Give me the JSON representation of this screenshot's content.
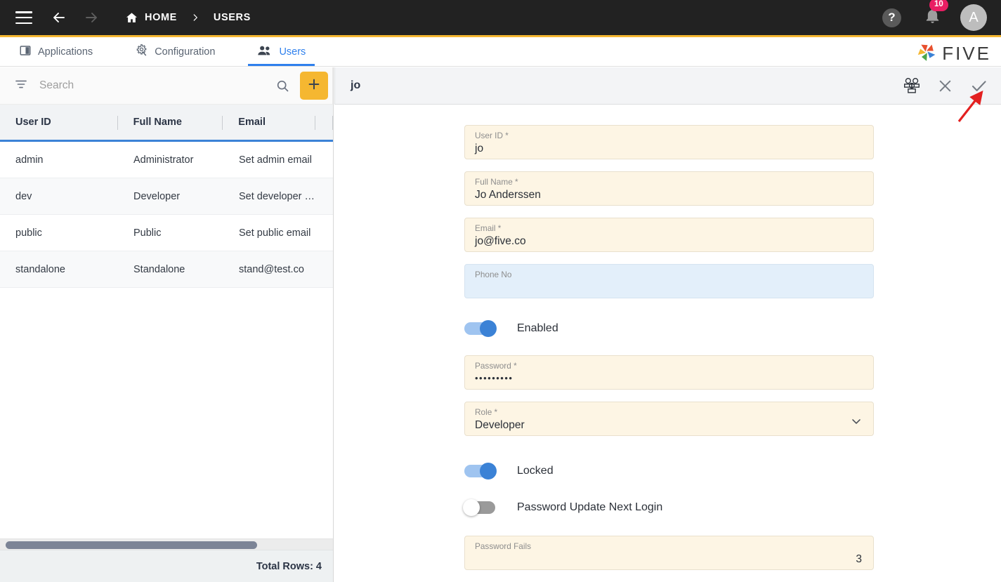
{
  "topbar": {
    "menu_icon": "hamburger-menu-icon",
    "back_icon": "arrow-back-icon",
    "forward_icon": "arrow-forward-icon",
    "home_icon": "home-icon",
    "breadcrumb_home": "HOME",
    "breadcrumb_sep": "chevron-right-icon",
    "breadcrumb_current": "USERS",
    "help_label": "?",
    "bell_icon": "notification-bell-icon",
    "notification_count": "10",
    "avatar_initial": "A",
    "accent_underline": "#F5B731",
    "bg": "#222222",
    "badge_color": "#E91E63"
  },
  "tabs": [
    {
      "label": "Applications",
      "icon": "applications-icon",
      "active": false
    },
    {
      "label": "Configuration",
      "icon": "configuration-gear-icon",
      "active": false
    },
    {
      "label": "Users",
      "icon": "users-group-icon",
      "active": true
    }
  ],
  "brand": {
    "name": "FIVE",
    "logo_icon": "five-pinwheel-logo-icon",
    "logo_colors": [
      "#E8502E",
      "#F5B731",
      "#4CA64C",
      "#3B82D6",
      "#E8502E"
    ]
  },
  "left_panel": {
    "filter_icon": "filter-icon",
    "search": {
      "value": "",
      "placeholder": "Search"
    },
    "search_icon": "search-icon",
    "add_button": {
      "icon": "plus-icon",
      "color": "#F5B731"
    },
    "columns": [
      "User ID",
      "Full Name",
      "Email",
      ""
    ],
    "rows": [
      {
        "user_id": "admin",
        "full_name": "Administrator",
        "email": "Set admin email"
      },
      {
        "user_id": "dev",
        "full_name": "Developer",
        "email": "Set developer em…"
      },
      {
        "user_id": "public",
        "full_name": "Public",
        "email": "Set public email"
      },
      {
        "user_id": "standalone",
        "full_name": "Standalone",
        "email": "stand@test.co"
      }
    ],
    "footer_total": "Total Rows: 4",
    "scrollbar": "horizontal-scrollbar"
  },
  "detail_panel": {
    "title": "jo",
    "actions": [
      {
        "name": "user-groups-icon",
        "glyph": "group"
      },
      {
        "name": "close-icon",
        "glyph": "x"
      },
      {
        "name": "save-check-icon",
        "glyph": "check"
      }
    ],
    "fields": [
      {
        "label": "User ID *",
        "value": "jo",
        "state": "normal"
      },
      {
        "label": "Full Name *",
        "value": "Jo Anderssen",
        "state": "normal"
      },
      {
        "label": "Email *",
        "value": "jo@five.co",
        "state": "normal"
      },
      {
        "label": "Phone No",
        "value": "",
        "state": "focused"
      }
    ],
    "toggle_enabled": {
      "label": "Enabled",
      "on": true
    },
    "password_field": {
      "label": "Password *",
      "value": "•••••••••"
    },
    "role_field": {
      "label": "Role *",
      "value": "Developer",
      "chevron": "chevron-down-icon"
    },
    "toggle_locked": {
      "label": "Locked",
      "on": true
    },
    "toggle_pwupdate": {
      "label": "Password Update Next Login",
      "on": false
    },
    "password_fails": {
      "label": "Password Fails",
      "value": "3"
    }
  },
  "annotation": {
    "arrow": "red-pointer-arrow",
    "color": "#E32020",
    "points_at": "save-check-icon"
  }
}
